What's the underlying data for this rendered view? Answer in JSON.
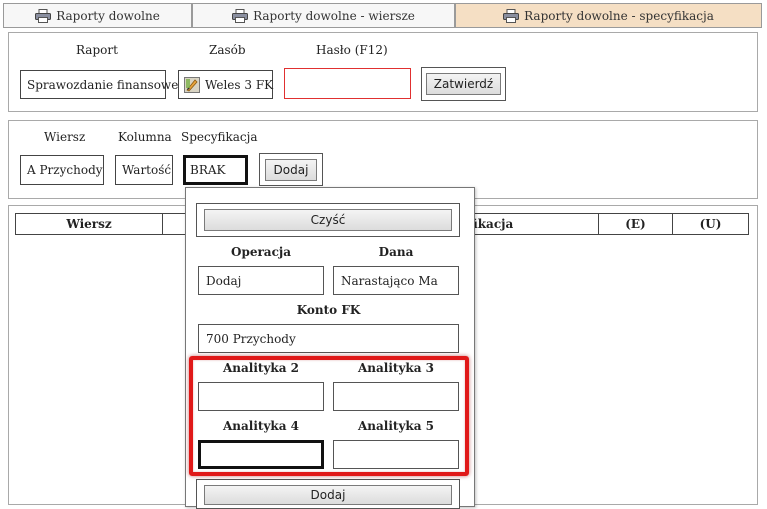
{
  "tabs": [
    {
      "label": "Raporty dowolne",
      "active": false,
      "icon": "printer-icon"
    },
    {
      "label": "Raporty dowolne - wiersze",
      "active": false,
      "icon": "printer-icon"
    },
    {
      "label": "Raporty dowolne - specyfikacja",
      "active": true,
      "icon": "printer-icon"
    }
  ],
  "report_panel": {
    "raport_label": "Raport",
    "zasob_label": "Zasób",
    "haslo_label": "Hasło (F12)",
    "raport_value": "Sprawozdanie finansowe",
    "zasob_value": "Weles 3 FK",
    "zasob_icon": "pencil-ruler-icon",
    "haslo_value": "",
    "confirm_button": "Zatwierdź"
  },
  "row_panel": {
    "wiersz_label": "Wiersz",
    "kolumna_label": "Kolumna",
    "specyfikacja_label": "Specyfikacja",
    "wiersz_value": "A Przychody",
    "kolumna_value": "Wartość",
    "specyfikacja_value": "BRAK",
    "add_button": "Dodaj"
  },
  "table": {
    "headers": [
      "Wiersz",
      "fikacja",
      "(E)",
      "(U)"
    ]
  },
  "popup": {
    "clear_button": "Czyść",
    "operacja_label": "Operacja",
    "dana_label": "Dana",
    "operacja_value": "Dodaj",
    "dana_value": "Narastająco Ma",
    "konto_label": "Konto FK",
    "konto_value": "700 Przychody",
    "analityka2_label": "Analityka 2",
    "analityka3_label": "Analityka 3",
    "analityka4_label": "Analityka 4",
    "analityka5_label": "Analityka 5",
    "analityka2_value": "",
    "analityka3_value": "",
    "analityka4_value": "",
    "analityka5_value": "",
    "add_button": "Dodaj"
  },
  "colors": {
    "active_tab": "#f5dfc4",
    "highlight": "#e01818",
    "password_border": "#e03030"
  }
}
